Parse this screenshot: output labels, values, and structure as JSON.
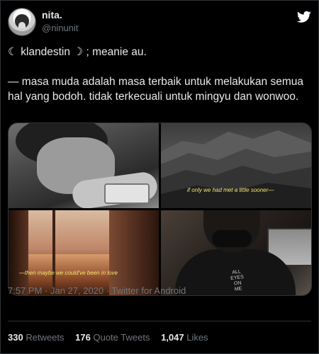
{
  "author": {
    "name": "nita.",
    "handle": "@ninunit",
    "avatar_icon": "avatar-image"
  },
  "brand": {
    "logo_icon": "twitter-bird-icon",
    "color": "#ffffff"
  },
  "tweet": {
    "line1": "☾ klandestin ☽ ; meanie au.",
    "line2": "— masa muda adalah masa terbaik untuk melakukan semua hal yang bodoh. tidak terkecuali untuk mingyu dan wonwoo."
  },
  "media": {
    "caption_top_right": "if only we had met a little sooner—",
    "caption_bottom_left": "—then maybe we could've been in love",
    "shirt_print": [
      "ALL",
      "EYES ON",
      "ME"
    ]
  },
  "meta": "7:57 PM · Jan 27, 2020 · Twitter for Android",
  "stats": {
    "retweets_count": "330",
    "retweets_label": "Retweets",
    "quotes_count": "176",
    "quotes_label": "Quote Tweets",
    "likes_count": "1,047",
    "likes_label": "Likes"
  },
  "colors": {
    "background": "#000000",
    "text": "#e7e9ea",
    "muted": "#71767b",
    "caption": "#f3e26a"
  }
}
